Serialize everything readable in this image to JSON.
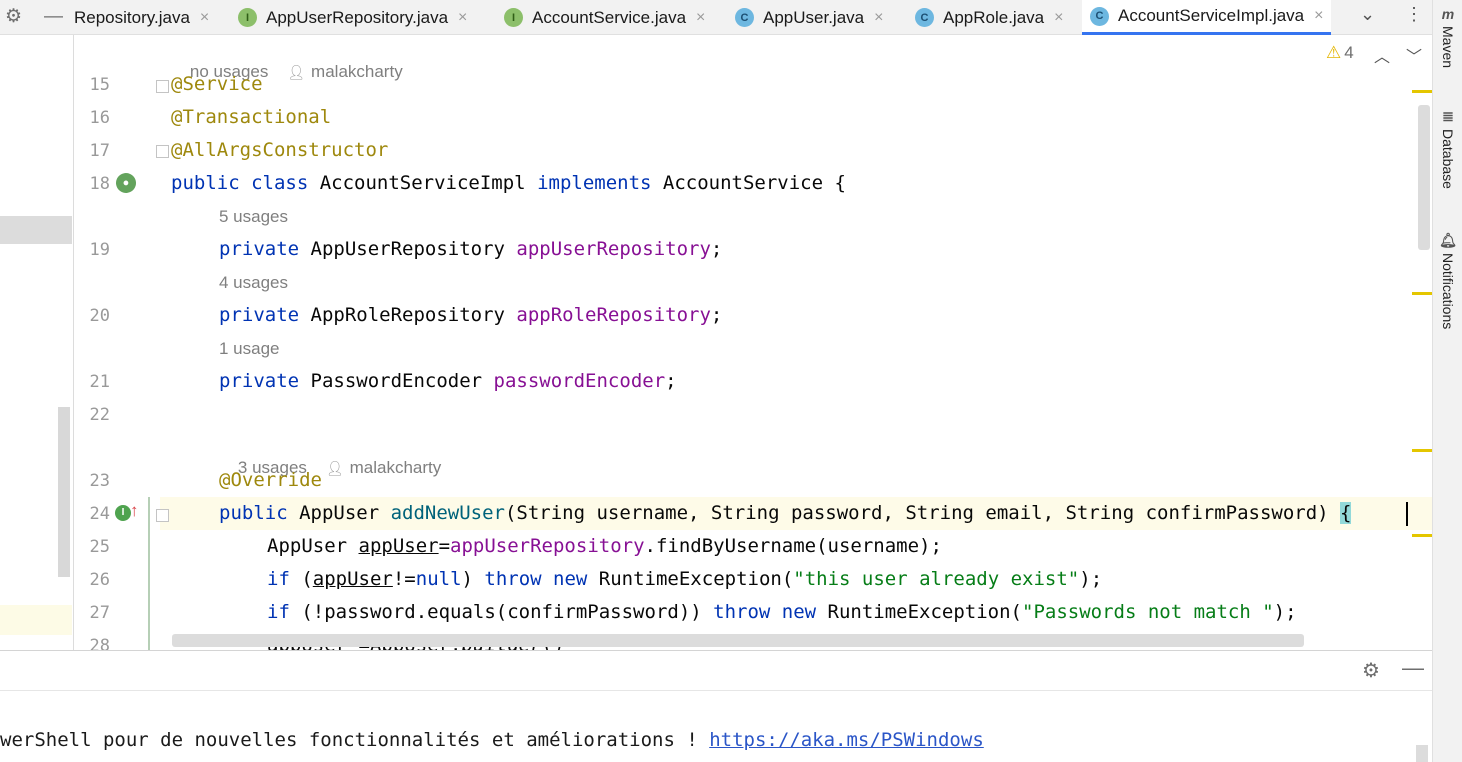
{
  "tabbar": {
    "settings_icon": "gear-icon",
    "minimize_icon": "minimize-icon",
    "tabs": [
      {
        "label": "Repository.java",
        "icon": "",
        "close": "×"
      },
      {
        "label": "AppUserRepository.java",
        "icon": "I",
        "close": "×"
      },
      {
        "label": "AccountService.java",
        "icon": "I",
        "close": "×"
      },
      {
        "label": "AppUser.java",
        "icon": "C",
        "close": "×"
      },
      {
        "label": "AppRole.java",
        "icon": "C",
        "close": "×"
      },
      {
        "label": "AccountServiceImpl.java",
        "icon": "C",
        "close": "×"
      }
    ],
    "active_tab_index": 5,
    "more_glyph": "⌄",
    "menu_glyph": "⋮"
  },
  "right_strip": {
    "items": [
      {
        "icon": "m",
        "label": "Maven"
      },
      {
        "icon": "database-icon",
        "label": "Database"
      },
      {
        "icon": "bell-icon",
        "label": "Notifications"
      }
    ]
  },
  "editor": {
    "inspection_warning_count": "4",
    "hints": {
      "class_usages": "no usages",
      "class_author": "malakcharty",
      "field1_usages": "5 usages",
      "field2_usages": "4 usages",
      "field3_usages": "1 usage",
      "method_usages": "3 usages",
      "method_author": "malakcharty"
    },
    "line_numbers": [
      "15",
      "16",
      "17",
      "18",
      "19",
      "20",
      "21",
      "22",
      "23",
      "24",
      "25",
      "26",
      "27",
      "28"
    ],
    "code": {
      "l15": "@Service",
      "l16": "@Transactional",
      "l17": "@AllArgsConstructor",
      "l18_kw": "public class",
      "l18_name": " AccountServiceImpl ",
      "l18_impl": "implements",
      "l18_rest": " AccountService {",
      "l19_kw": "private",
      "l19_type": " AppUserRepository ",
      "l19_field": "appUserRepository",
      "l19_end": ";",
      "l20_kw": "private",
      "l20_type": " AppRoleRepository ",
      "l20_field": "appRoleRepository",
      "l20_end": ";",
      "l21_kw": "private",
      "l21_type": " PasswordEncoder ",
      "l21_field": "passwordEncoder",
      "l21_end": ";",
      "l23": "@Override",
      "l24_kw": "public",
      "l24_type": " AppUser ",
      "l24_method": "addNewUser",
      "l24_params": "(String username, String password, String email, String confirmPassword) ",
      "l24_brace": "{",
      "l25_type": "AppUser ",
      "l25_var": "appUser",
      "l25_eq": "=",
      "l25_field": "appUserRepository",
      "l25_rest": ".findByUsername(username);",
      "l26_kw": "if",
      "l26_a": " (",
      "l26_var": "appUser",
      "l26_b": "!=",
      "l26_null": "null",
      "l26_c": ") ",
      "l26_throw": "throw new",
      "l26_d": " RuntimeException(",
      "l26_str": "\"this user already exist\"",
      "l26_e": ");",
      "l27_kw": "if",
      "l27_a": " (!password.equals(confirmPassword)) ",
      "l27_throw": "throw new",
      "l27_b": " RuntimeException(",
      "l27_str": "\"Passwords not match \"",
      "l27_c": ");",
      "l28_a": "appUser =AppUser.",
      "l28_b": "builder",
      "l28_c": "()"
    }
  },
  "terminal": {
    "text": "werShell pour de nouvelles fonctionnalités et améliorations ! ",
    "link": "https://aka.ms/PSWindows"
  }
}
